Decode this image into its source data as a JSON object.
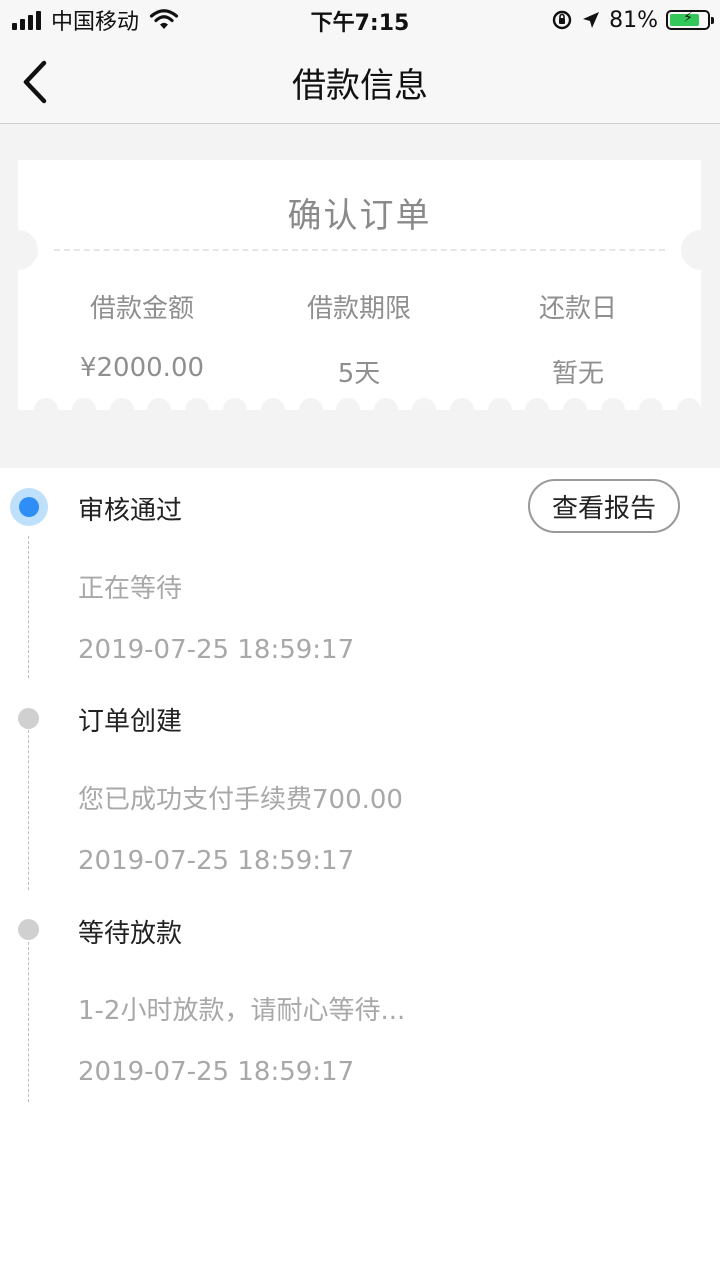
{
  "status_bar": {
    "carrier": "中国移动",
    "time": "下午7:15",
    "battery_percent": "81%",
    "battery_level": 0.81
  },
  "nav": {
    "title": "借款信息",
    "back_icon": "chevron-left-icon"
  },
  "order_card": {
    "title": "确认订单",
    "columns": [
      {
        "label": "借款金额",
        "value": "¥2000.00"
      },
      {
        "label": "借款期限",
        "value": "5天"
      },
      {
        "label": "还款日",
        "value": "暂无"
      }
    ]
  },
  "timeline": {
    "report_button": "查看报告",
    "steps": [
      {
        "title": "审核通过",
        "desc": "正在等待",
        "time": "2019-07-25 18:59:17",
        "active": true
      },
      {
        "title": "订单创建",
        "desc": "您已成功支付手续费700.00",
        "time": "2019-07-25 18:59:17",
        "active": false
      },
      {
        "title": "等待放款",
        "desc": "1-2小时放款，请耐心等待...",
        "time": "2019-07-25 18:59:17",
        "active": false
      }
    ]
  },
  "colors": {
    "accent": "#2f8ef5",
    "accent_halo": "#bfe0fb",
    "inactive_dot": "#d0d0d0",
    "muted_text": "#a8a8a8"
  }
}
